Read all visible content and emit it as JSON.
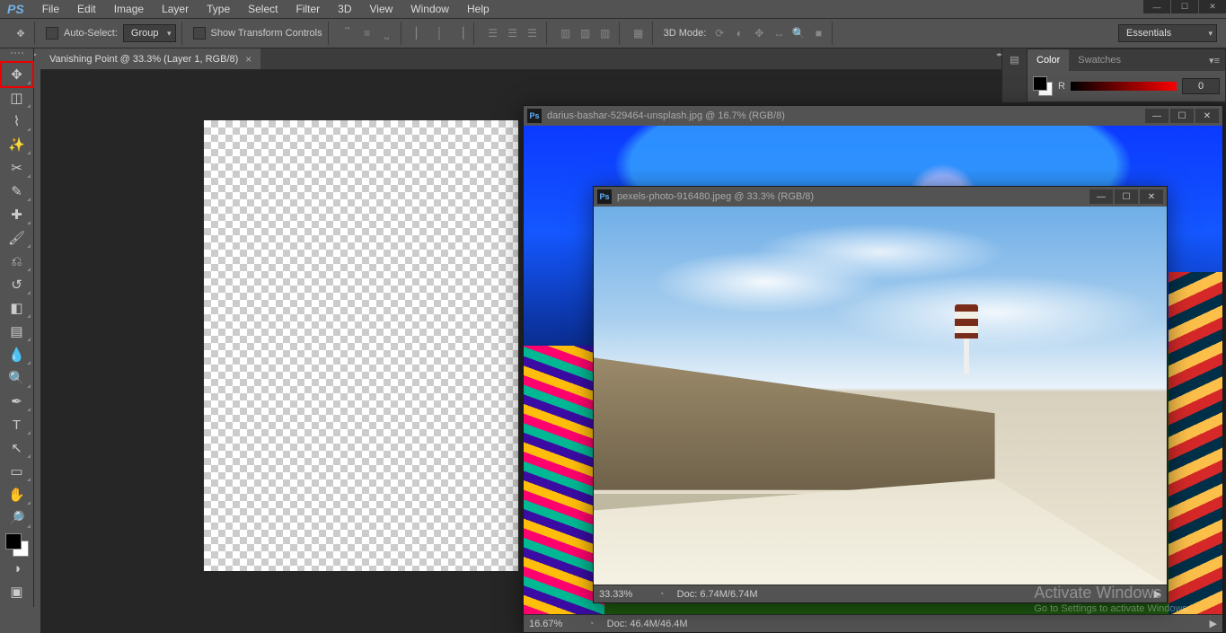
{
  "app_logo": "PS",
  "menu": [
    "File",
    "Edit",
    "Image",
    "Layer",
    "Type",
    "Select",
    "Filter",
    "3D",
    "View",
    "Window",
    "Help"
  ],
  "optionbar": {
    "auto_select_label": "Auto-Select:",
    "auto_select_target": "Group",
    "show_transform": "Show Transform Controls",
    "threeD_label": "3D Mode:"
  },
  "workspace_label": "Essentials",
  "main_tab": "Vanishing Point @ 33.3% (Layer 1, RGB/8)",
  "tools": [
    "move",
    "marquee",
    "lasso",
    "wand",
    "crop",
    "eyedrop",
    "heal",
    "brush",
    "stamp",
    "history",
    "eraser",
    "gradient",
    "blur",
    "dodge",
    "pen",
    "type",
    "path",
    "shape",
    "hand",
    "zoom"
  ],
  "color_panel": {
    "tab_color": "Color",
    "tab_swatches": "Swatches",
    "channel": "R",
    "value": "0"
  },
  "win1": {
    "title": "darius-bashar-529464-unsplash.jpg @ 16.7% (RGB/8)",
    "zoom": "16.67%",
    "doc": "Doc: 46.4M/46.4M"
  },
  "win2": {
    "title": "pexels-photo-916480.jpeg @ 33.3% (RGB/8)",
    "zoom": "33.33%",
    "doc": "Doc: 6.74M/6.74M"
  },
  "watermark_title": "Activate Windows",
  "watermark_sub": "Go to Settings to activate Windows."
}
